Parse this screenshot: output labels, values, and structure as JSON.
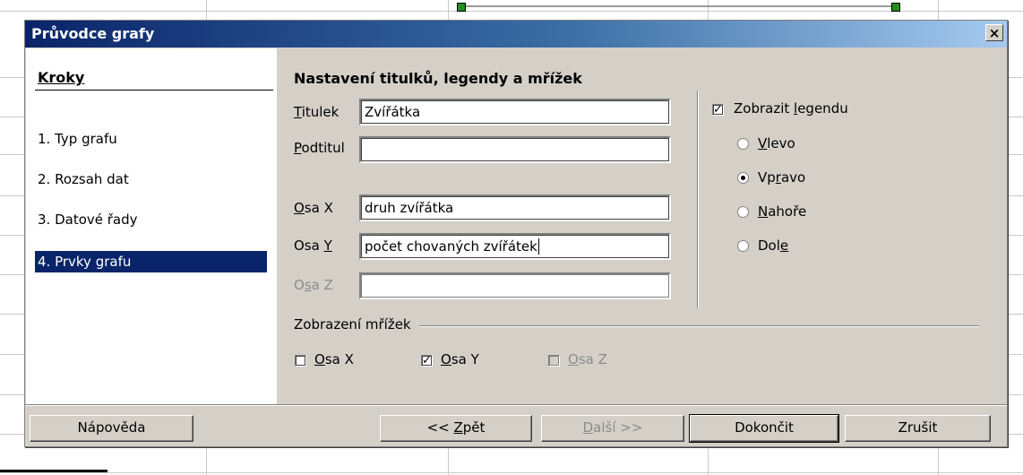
{
  "dialog": {
    "title": "Průvodce grafy",
    "close_label": "×"
  },
  "steps": {
    "title": "Kroky",
    "items": [
      {
        "label": "1. Typ grafu"
      },
      {
        "label": "2. Rozsah dat"
      },
      {
        "label": "3. Datové řady"
      },
      {
        "label": "4. Prvky grafu",
        "active": true
      }
    ]
  },
  "main": {
    "heading": "Nastavení titulků, legendy a mřížek",
    "fields": {
      "title": {
        "label": "Titulek",
        "value": "Zvířátka"
      },
      "subtitle": {
        "label": "Podtitul",
        "value": ""
      },
      "x_axis": {
        "label": "Osa X",
        "value": "druh zvířátka"
      },
      "y_axis": {
        "label": "Osa Y",
        "value": "počet chovaných zvířátek"
      },
      "z_axis": {
        "label": "Osa Z",
        "value": "",
        "disabled": true
      }
    },
    "legend": {
      "show_label": "Zobrazit legendu",
      "show_checked": true,
      "options": [
        "Vlevo",
        "Vpravo",
        "Nahoře",
        "Dole"
      ],
      "selected": "Vpravo"
    },
    "grids": {
      "group_label": "Zobrazení mřížek",
      "x": {
        "label": "Osa X",
        "checked": false
      },
      "y": {
        "label": "Osa Y",
        "checked": true
      },
      "z": {
        "label": "Osa Z",
        "checked": false,
        "disabled": true
      }
    }
  },
  "buttons": {
    "help": "Nápověda",
    "back": "<< Zpět",
    "next": "Další >>",
    "finish": "Dokončit",
    "cancel": "Zrušit"
  },
  "colors": {
    "titlebar_start": "#0a246a",
    "titlebar_end": "#a6caf0",
    "selection": "#0a246a",
    "dialog_face": "#d4d0c8"
  }
}
